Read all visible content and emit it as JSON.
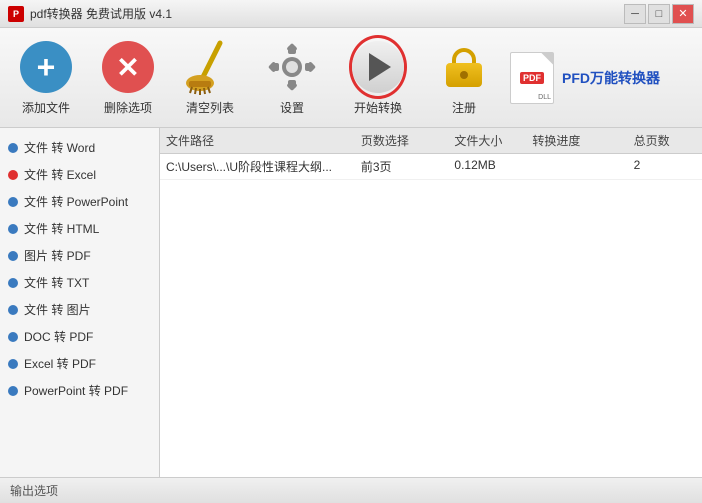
{
  "titlebar": {
    "title": "pdf转换器 免费试用版 v4.1",
    "controls": {
      "minimize": "─",
      "maximize": "□",
      "close": "✕"
    }
  },
  "toolbar": {
    "add_file": "添加文件",
    "delete_item": "删除选项",
    "clear_list": "清空列表",
    "settings": "设置",
    "start_convert": "开始转换",
    "register": "注册",
    "brand": "PFD万能转换器"
  },
  "sidebar": {
    "items": [
      {
        "label": "文件 转 Word",
        "dot": "blue",
        "active": false
      },
      {
        "label": "文件 转 Excel",
        "dot": "red",
        "active": false
      },
      {
        "label": "文件 转 PowerPoint",
        "dot": "blue",
        "active": false
      },
      {
        "label": "文件 转 HTML",
        "dot": "blue",
        "active": false
      },
      {
        "label": "图片 转 PDF",
        "dot": "blue",
        "active": false
      },
      {
        "label": "文件 转 TXT",
        "dot": "blue",
        "active": false
      },
      {
        "label": "文件 转 图片",
        "dot": "blue",
        "active": false
      },
      {
        "label": "DOC 转 PDF",
        "dot": "blue",
        "active": false
      },
      {
        "label": "Excel 转 PDF",
        "dot": "blue",
        "active": false
      },
      {
        "label": "PowerPoint 转 PDF",
        "dot": "blue",
        "active": false
      }
    ]
  },
  "table": {
    "headers": {
      "path": "文件路径",
      "pages": "页数选择",
      "size": "文件大小",
      "progress": "转换进度",
      "total": "总页数"
    },
    "rows": [
      {
        "path": "C:\\Users\\...\\U阶段性课程大纲...",
        "pages": "前3页",
        "size": "0.12MB",
        "progress": "",
        "total": "2"
      }
    ]
  },
  "bottom": {
    "label": "输出选项"
  }
}
